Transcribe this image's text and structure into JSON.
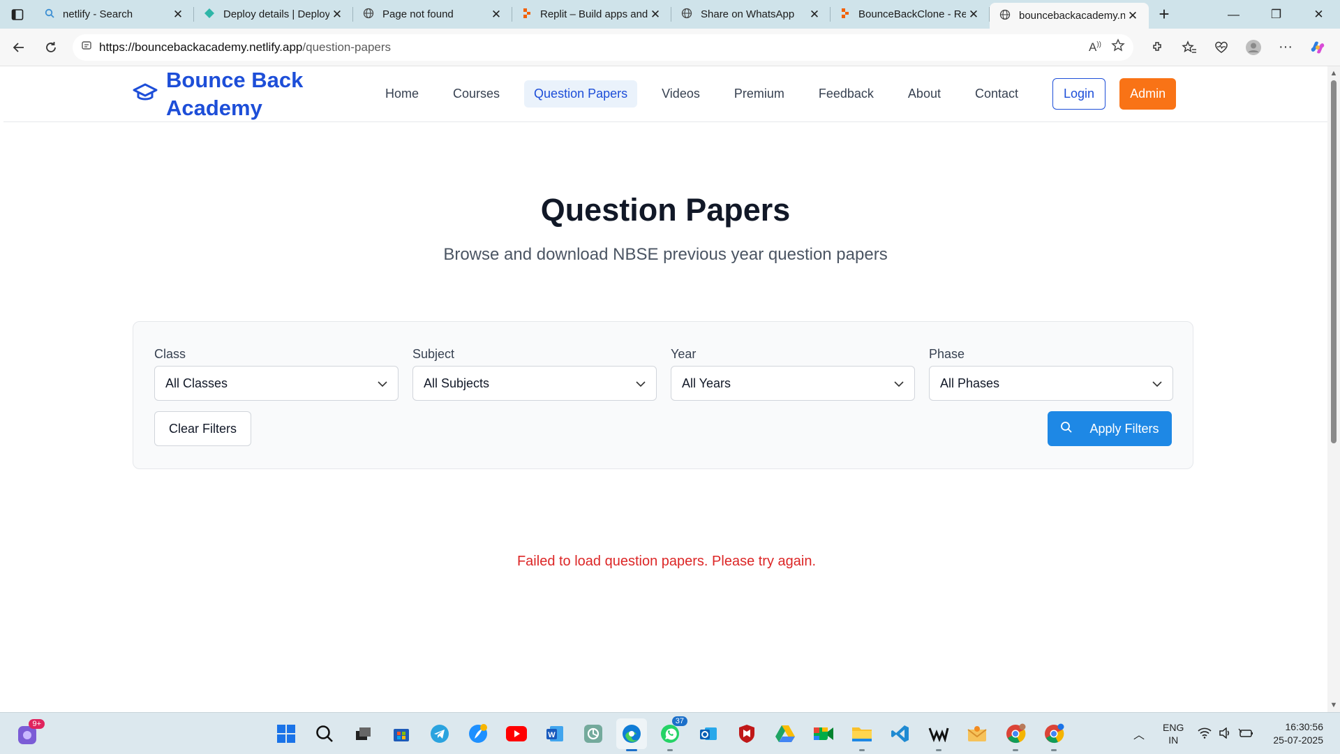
{
  "browser": {
    "tabs": [
      {
        "title": "netlify - Search",
        "icon": "search-icon"
      },
      {
        "title": "Deploy details | Deploy",
        "icon": "netlify-icon"
      },
      {
        "title": "Page not found",
        "icon": "globe-icon"
      },
      {
        "title": "Replit – Build apps and",
        "icon": "replit-icon"
      },
      {
        "title": "Share on WhatsApp",
        "icon": "globe-icon"
      },
      {
        "title": "BounceBackClone - Re",
        "icon": "replit-icon"
      },
      {
        "title": "bouncebackacademy.n",
        "icon": "globe-icon",
        "active": true
      }
    ],
    "url_host": "https://bouncebackacademy.netlify.app",
    "url_path": "/question-papers"
  },
  "site": {
    "brand_line1": "Bounce Back",
    "brand_line2": "Academy",
    "nav": {
      "home": "Home",
      "courses": "Courses",
      "question_papers": "Question Papers",
      "videos": "Videos",
      "premium": "Premium",
      "feedback": "Feedback",
      "about": "About",
      "contact": "Contact"
    },
    "login": "Login",
    "admin": "Admin",
    "accent": "#1d4ed8",
    "admin_color": "#f97316"
  },
  "page": {
    "title": "Question Papers",
    "subtitle": "Browse and download NBSE previous year question papers"
  },
  "filters": {
    "class_label": "Class",
    "class_value": "All Classes",
    "subject_label": "Subject",
    "subject_value": "All Subjects",
    "year_label": "Year",
    "year_value": "All Years",
    "phase_label": "Phase",
    "phase_value": "All Phases",
    "clear": "Clear Filters",
    "apply": "Apply Filters"
  },
  "error_message": "Failed to load question papers. Please try again.",
  "taskbar": {
    "widget_badge": "9+",
    "whatsapp_badge": "37",
    "lang_line1": "ENG",
    "lang_line2": "IN",
    "time": "16:30:56",
    "date": "25-07-2025"
  }
}
